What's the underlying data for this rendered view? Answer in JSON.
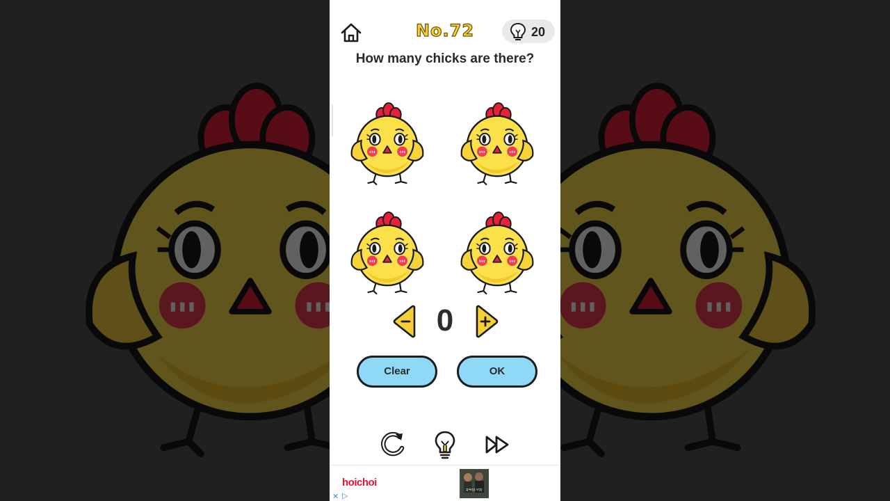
{
  "header": {
    "level_label": "No.72",
    "hint_count": "20"
  },
  "question": "How many chicks are there?",
  "counter": {
    "value": "0"
  },
  "buttons": {
    "clear_label": "Clear",
    "ok_label": "OK"
  },
  "icons": {
    "home": "home-icon",
    "hint": "lightbulb-icon",
    "minus": "minus-arrow-icon",
    "plus": "plus-arrow-icon",
    "restart": "restart-icon",
    "hint_tool": "lightbulb-icon",
    "skip": "fast-forward-icon"
  },
  "ad": {
    "brand": "hoichoi",
    "thumb_text": "মন্দার দায়"
  },
  "colors": {
    "title_yellow": "#f4cf3a",
    "button_blue": "#8fd8f6",
    "chick_yellow": "#fbe04a",
    "comb_red": "#e8203a",
    "ad_red": "#e8132d"
  }
}
